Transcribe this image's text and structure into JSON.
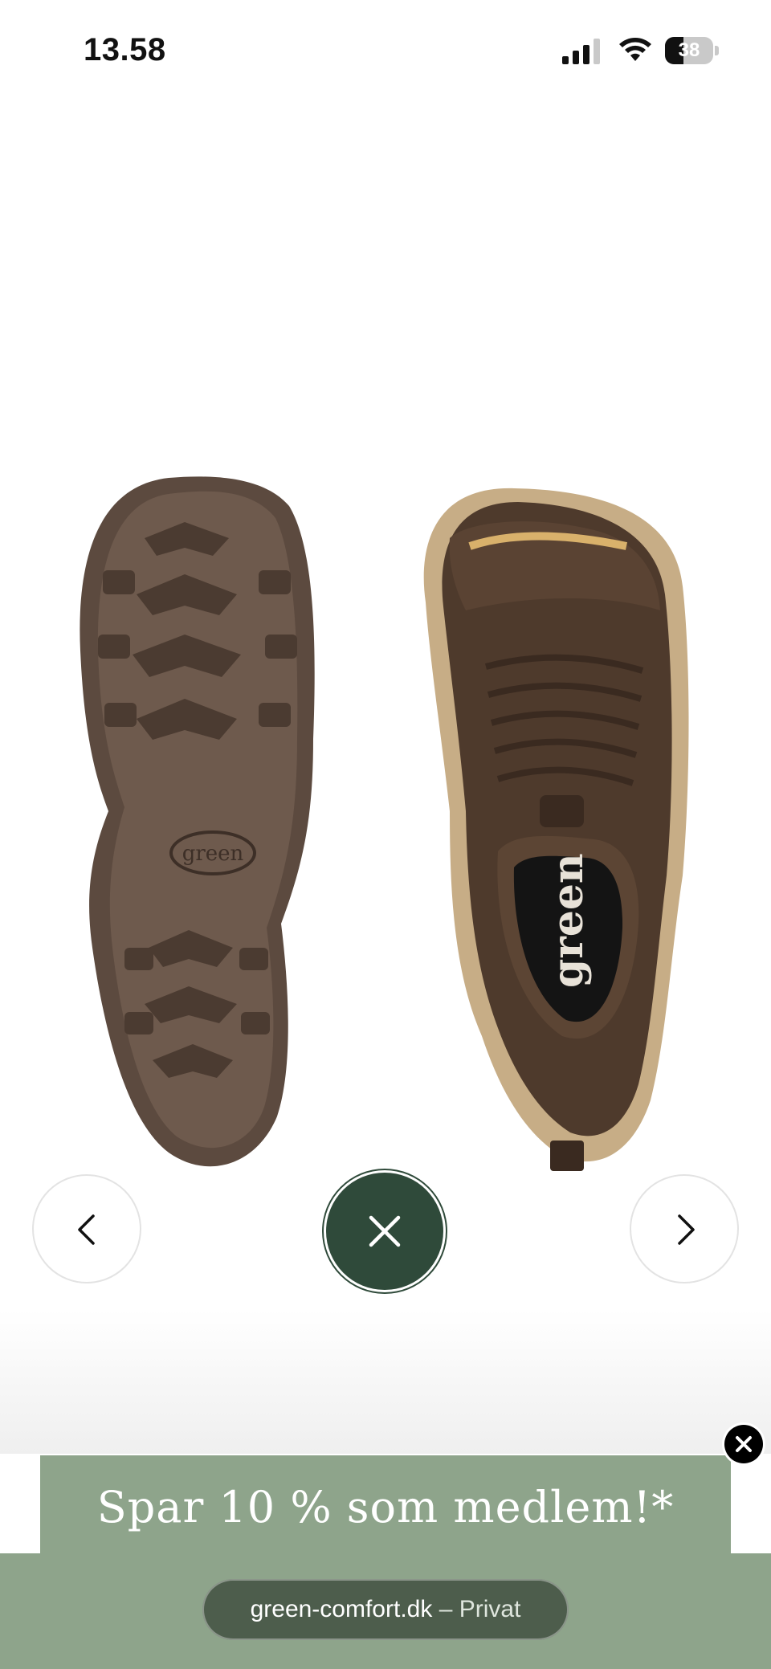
{
  "status_bar": {
    "time": "13.58",
    "battery_level": "38",
    "battery_fraction": 0.38
  },
  "gallery": {
    "prev_icon": "chevron-left-icon",
    "next_icon": "chevron-right-icon",
    "close_icon": "close-icon",
    "accent_color": "#2f4a3a",
    "image_icon": "shoe-image"
  },
  "promo": {
    "text": "Spar 10 % som medlem!*",
    "background_color": "#8ea48b",
    "close_icon": "close-icon"
  },
  "browser": {
    "domain": "green-comfort.dk",
    "separator": "–",
    "mode": "Privat"
  }
}
